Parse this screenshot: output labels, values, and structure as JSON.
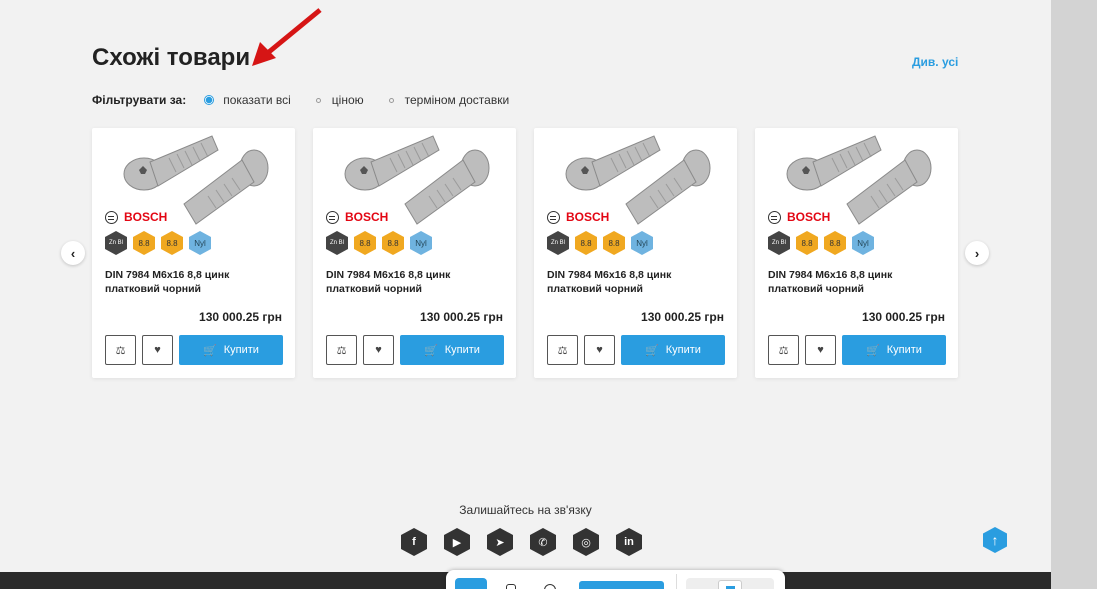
{
  "section": {
    "title": "Схожі товари",
    "see_all": "Див. усі"
  },
  "filter": {
    "label": "Фільтрувати за:",
    "options": [
      {
        "label": "показати всі",
        "selected": true
      },
      {
        "label": "ціною",
        "selected": false
      },
      {
        "label": "терміном доставки",
        "selected": false
      }
    ]
  },
  "products": [
    {
      "brand": "BOSCH",
      "badges": [
        "Zn Bl",
        "8.8",
        "8.8",
        "Nyl"
      ],
      "name": "DIN 7984 М6х16 8,8 цинк платковий чорний",
      "price": "130 000.25 грн",
      "buy_label": "Купити"
    },
    {
      "brand": "BOSCH",
      "badges": [
        "Zn Bl",
        "8.8",
        "8.8",
        "Nyl"
      ],
      "name": "DIN 7984 М6х16 8,8 цинк платковий чорний",
      "price": "130 000.25 грн",
      "buy_label": "Купити"
    },
    {
      "brand": "BOSCH",
      "badges": [
        "Zn Bl",
        "8.8",
        "8.8",
        "Nyl"
      ],
      "name": "DIN 7984 М6х16 8,8 цинк платковий чорний",
      "price": "130 000.25 грн",
      "buy_label": "Купити"
    },
    {
      "brand": "BOSCH",
      "badges": [
        "Zn Bl",
        "8.8",
        "8.8",
        "Nyl"
      ],
      "name": "DIN 7984 М6х16 8,8 цинк платковий чорний",
      "price": "130 000.25 грн",
      "buy_label": "Купити"
    }
  ],
  "footer": {
    "stay_connected": "Залишайтесь на зв'язку",
    "socials": [
      "facebook-icon",
      "youtube-icon",
      "telegram-icon",
      "whatsapp-icon",
      "instagram-icon",
      "linkedin-icon"
    ]
  },
  "colors": {
    "accent": "#2a9de0",
    "brand_red": "#e30613",
    "badge_orange": "#f0a820",
    "badge_blue": "#6fb3e0"
  }
}
